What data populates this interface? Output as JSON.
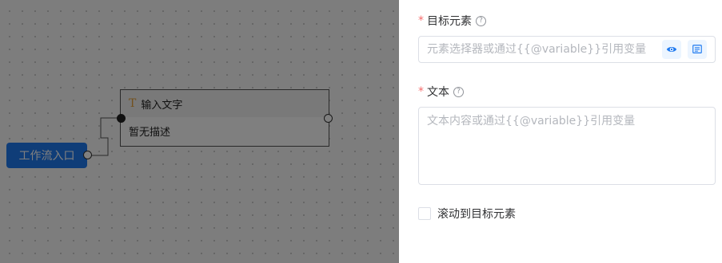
{
  "canvas": {
    "entry_node": {
      "label": "工作流入口"
    },
    "task_node": {
      "icon": "text-type-icon",
      "icon_glyph": "T",
      "title": "输入文字",
      "description": "暂无描述"
    }
  },
  "drawer": {
    "target_element": {
      "required_mark": "*",
      "label": "目标元素",
      "help_glyph": "?",
      "placeholder": "元素选择器或通过{{@variable}}引用变量",
      "value": "",
      "preview_icon": "eye-icon",
      "picker_icon": "element-picker-icon"
    },
    "text": {
      "required_mark": "*",
      "label": "文本",
      "help_glyph": "?",
      "placeholder": "文本内容或通过{{@variable}}引用变量",
      "value": ""
    },
    "scroll_checkbox": {
      "label": "滚动到目标元素",
      "checked": false
    }
  },
  "colors": {
    "accent": "#1f7af0",
    "required": "#f56c6c",
    "overlay": "rgba(0,0,0,0.5)",
    "icon_warning": "#e6a23c"
  }
}
